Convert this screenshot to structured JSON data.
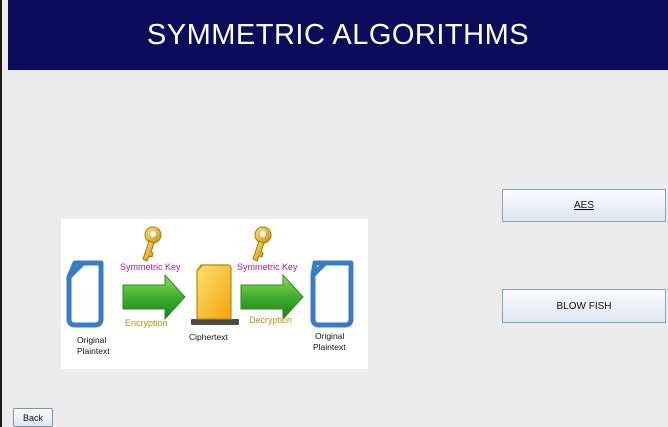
{
  "header": {
    "title": "SYMMETRIC ALGORITHMS"
  },
  "buttons": {
    "aes": "AES",
    "blowfish": "BLOW FISH",
    "back": "Back"
  },
  "diagram": {
    "key_label_left": "Symmetric Key",
    "key_label_right": "Symmetric Key",
    "encryption": "Encryption",
    "decryption": "Decryption",
    "original_left_1": "Original",
    "original_left_2": "Plaintext",
    "ciphertext": "Ciphertext",
    "original_right_1": "Original",
    "original_right_2": "Plaintext"
  },
  "colors": {
    "header_bg": "#0c0c5c",
    "doc_blue": "#3a7cc3",
    "key_gold": "#e6b21f",
    "arrow_green": "#3aa52a",
    "key_label_magenta": "#b2189e",
    "process_label_orange": "#c88a12",
    "cipher_yellow": "#f7b712"
  }
}
